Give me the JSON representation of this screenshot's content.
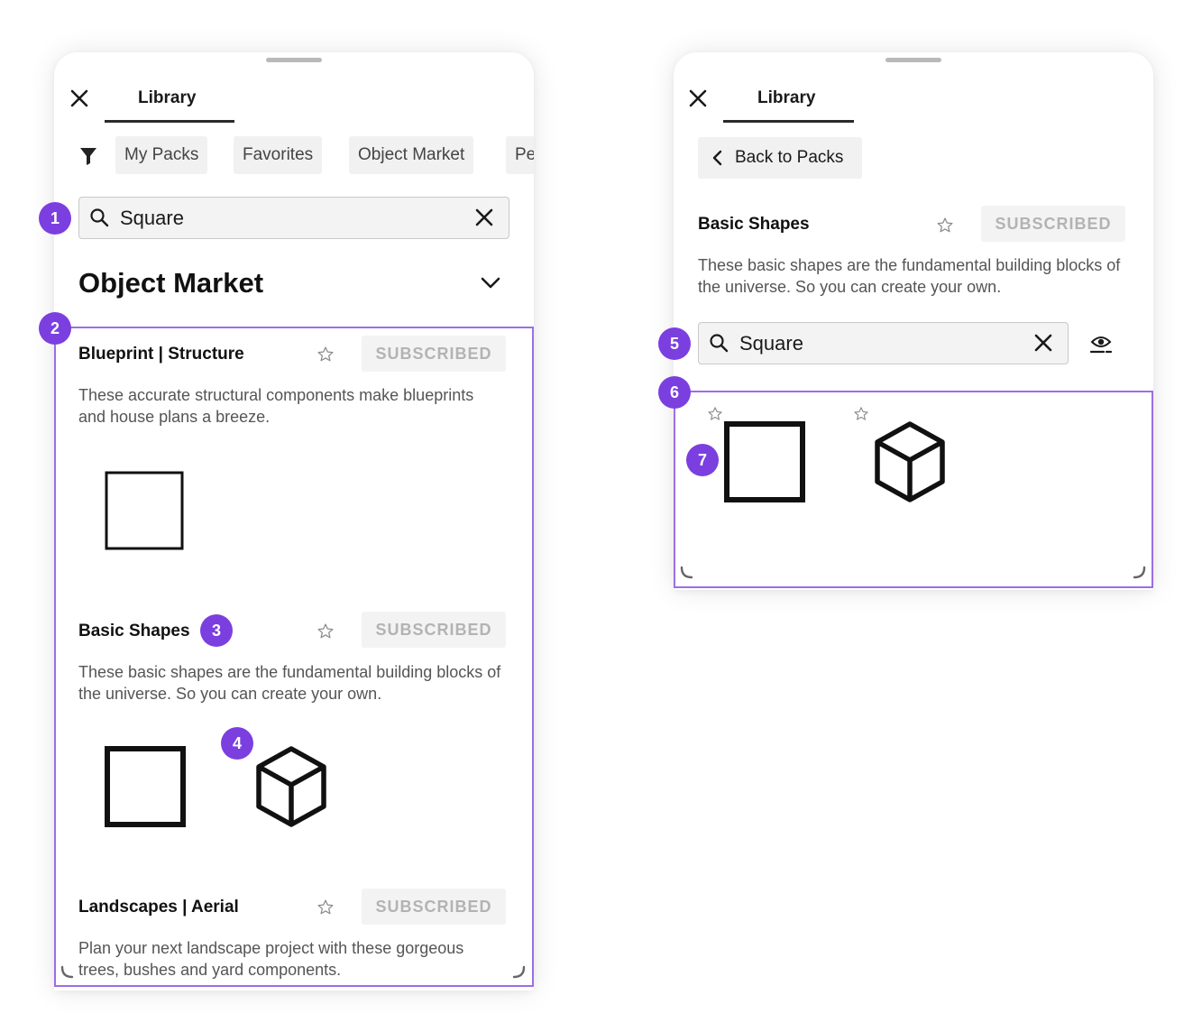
{
  "left_panel": {
    "tab_label": "Library",
    "filters": [
      "My Packs",
      "Favorites",
      "Object Market",
      "Pe"
    ],
    "search": {
      "value": "Square"
    },
    "section_title": "Object Market",
    "packs": [
      {
        "name": "Blueprint | Structure",
        "status": "SUBSCRIBED",
        "description": "These accurate structural components make blueprints and house plans a breeze."
      },
      {
        "name": "Basic Shapes",
        "status": "SUBSCRIBED",
        "description": "These basic shapes are the fundamental building blocks of the universe. So you can create your own."
      },
      {
        "name": "Landscapes | Aerial",
        "status": "SUBSCRIBED",
        "description": "Plan your next landscape project with these gorgeous trees, bushes and yard components."
      }
    ]
  },
  "right_panel": {
    "tab_label": "Library",
    "back_label": "Back to Packs",
    "pack": {
      "name": "Basic Shapes",
      "status": "SUBSCRIBED",
      "description": "These basic shapes are the fundamental building blocks of the universe. So you can create your own."
    },
    "search": {
      "value": "Square"
    }
  },
  "markers": [
    "1",
    "2",
    "3",
    "4",
    "5",
    "6",
    "7"
  ],
  "icons": {
    "close": "close-icon",
    "filter": "filter-icon",
    "search": "search-icon",
    "clear": "clear-icon",
    "chevron": "chevron-down-icon",
    "star": "star-icon",
    "back": "chevron-left-icon",
    "visibility": "eye-icon",
    "square": "square-icon",
    "cube": "cube-icon"
  },
  "colors": {
    "accent": "#7b3fe0",
    "highlight_border": "#9c6ee3",
    "badge_text": "#b3b3b3",
    "chip_bg": "#f1f1f1"
  }
}
